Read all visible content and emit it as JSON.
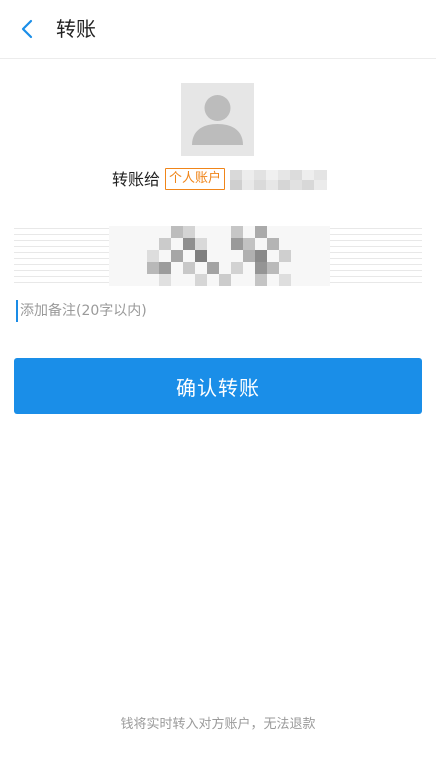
{
  "header": {
    "back_icon": "chevron-left-icon",
    "title": "转账"
  },
  "recipient": {
    "avatar_icon": "user-silhouette-icon",
    "to_label": "转账给",
    "account_type_badge": "个人账户",
    "name_masked": true
  },
  "amount": {
    "masked": true
  },
  "memo": {
    "placeholder": "添加备注(20字以内)",
    "value": ""
  },
  "confirm_button": {
    "label": "确认转账"
  },
  "footer": {
    "note": "钱将实时转入对方账户，无法退款"
  },
  "colors": {
    "accent": "#1a8ee8",
    "badge": "#f08519",
    "placeholder_gray": "#9a9a9a"
  }
}
